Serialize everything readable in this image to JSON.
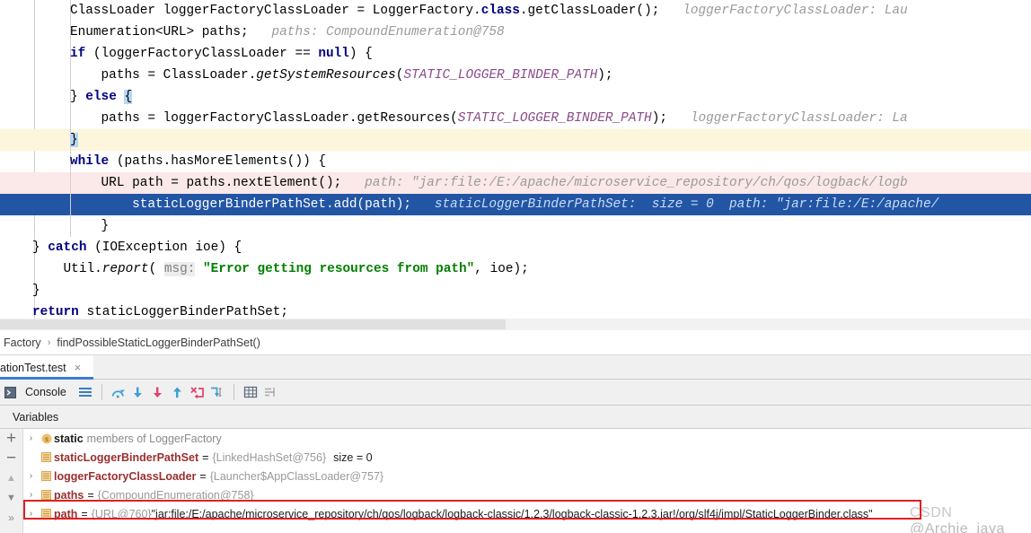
{
  "editor": {
    "lines": [
      {
        "id": "line-classloader",
        "indent": 78,
        "segments": [
          {
            "t": "ClassLoader loggerFactoryClassLoader = LoggerFactory.",
            "c": "plain"
          },
          {
            "t": "class",
            "c": "kw"
          },
          {
            "t": ".getClassLoader();",
            "c": "plain"
          },
          {
            "t": "   loggerFactoryClassLoader: Lau",
            "c": "hint"
          }
        ]
      },
      {
        "id": "line-enumeration",
        "indent": 78,
        "segments": [
          {
            "t": "Enumeration<URL> paths;",
            "c": "plain"
          },
          {
            "t": "   paths: CompoundEnumeration@758",
            "c": "hint"
          }
        ]
      },
      {
        "id": "line-if",
        "indent": 78,
        "segments": [
          {
            "t": "if",
            "c": "kw"
          },
          {
            "t": " (loggerFactoryClassLoader == ",
            "c": "plain"
          },
          {
            "t": "null",
            "c": "kw"
          },
          {
            "t": ") {",
            "c": "plain"
          }
        ]
      },
      {
        "id": "line-paths-system",
        "indent": 78,
        "segments": [
          {
            "t": "    paths = ClassLoader.",
            "c": "plain"
          },
          {
            "t": "getSystemResources",
            "c": "mth"
          },
          {
            "t": "(",
            "c": "plain"
          },
          {
            "t": "STATIC_LOGGER_BINDER_PATH",
            "c": "const"
          },
          {
            "t": ");",
            "c": "plain"
          }
        ]
      },
      {
        "id": "line-else",
        "indent": 78,
        "segments": [
          {
            "t": "} ",
            "c": "plain"
          },
          {
            "t": "else",
            "c": "kw"
          },
          {
            "t": " ",
            "c": "plain"
          },
          {
            "t": "{",
            "c": "brace-sel"
          }
        ]
      },
      {
        "id": "line-paths-resources",
        "indent": 78,
        "segments": [
          {
            "t": "    paths = loggerFactoryClassLoader.getResources(",
            "c": "plain"
          },
          {
            "t": "STATIC_LOGGER_BINDER_PATH",
            "c": "const"
          },
          {
            "t": ");",
            "c": "plain"
          },
          {
            "t": "   loggerFactoryClassLoader: La",
            "c": "hint"
          }
        ]
      },
      {
        "id": "line-close-else",
        "indent": 78,
        "highlight": "yellow",
        "segments": [
          {
            "t": "}",
            "c": "brace-sel"
          }
        ]
      },
      {
        "id": "line-while",
        "indent": 78,
        "segments": [
          {
            "t": "while",
            "c": "kw"
          },
          {
            "t": " (paths.hasMoreElements()) {",
            "c": "plain"
          }
        ]
      },
      {
        "id": "line-url-path",
        "indent": 78,
        "highlight": "pink",
        "segments": [
          {
            "t": "    URL path = paths.nextElement();",
            "c": "plain"
          },
          {
            "t": "   path: \"jar:file:/E:/apache/microservice_repository/ch/qos/logback/logb",
            "c": "hint"
          }
        ]
      },
      {
        "id": "line-add-path",
        "indent": 78,
        "highlight": "blue",
        "segments": [
          {
            "t": "        staticLoggerBinderPathSet.add(path);",
            "c": "plain"
          },
          {
            "t": "   staticLoggerBinderPathSet:  size = 0  path: \"jar:file:/E:/apache/",
            "c": "hint"
          }
        ]
      },
      {
        "id": "line-close-while",
        "indent": 78,
        "segments": [
          {
            "t": "    }",
            "c": "plain"
          }
        ]
      },
      {
        "id": "line-catch",
        "indent": 36,
        "segments": [
          {
            "t": "} ",
            "c": "plain"
          },
          {
            "t": "catch",
            "c": "kw"
          },
          {
            "t": " (IOException ioe) {",
            "c": "plain"
          }
        ]
      },
      {
        "id": "line-util-report",
        "indent": 36,
        "segments": [
          {
            "t": "    Util.",
            "c": "plain"
          },
          {
            "t": "report",
            "c": "mth"
          },
          {
            "t": "( ",
            "c": "plain"
          },
          {
            "t": "msg:",
            "c": "param"
          },
          {
            "t": " ",
            "c": "plain"
          },
          {
            "t": "\"Error getting resources from path\"",
            "c": "str"
          },
          {
            "t": ", ioe);",
            "c": "plain"
          }
        ]
      },
      {
        "id": "line-close-catch",
        "indent": 36,
        "segments": [
          {
            "t": "}",
            "c": "plain"
          }
        ]
      },
      {
        "id": "line-return",
        "indent": 36,
        "segments": [
          {
            "t": "return",
            "c": "kw"
          },
          {
            "t": " staticLoggerBinderPathSet;",
            "c": "plain"
          }
        ]
      },
      {
        "id": "line-close-method",
        "indent": 0,
        "segments": [
          {
            "t": "}",
            "c": "plain"
          }
        ]
      }
    ]
  },
  "breadcrumb": {
    "crumb1": "Factory",
    "separator": "›",
    "crumb2": "findPossibleStaticLoggerBinderPathSet()"
  },
  "run_tab": {
    "label": "ationTest.test",
    "close_icon": "×"
  },
  "debug_toolbar": {
    "console_label": "Console",
    "icons": [
      "console-toggle-icon",
      "list-view-icon",
      "step-over-icon",
      "step-into-icon",
      "force-step-into-icon",
      "step-out-icon",
      "drop-frame-icon",
      "run-to-cursor-icon",
      "evaluate-expression-icon",
      "mute-breakpoints-icon"
    ]
  },
  "variables_header": {
    "label": "Variables"
  },
  "variables_sidebar": {
    "add_icon": "+",
    "remove_icon": "−",
    "up_icon": "▲",
    "down_icon": "▼",
    "expand_icon": "»"
  },
  "variables": {
    "rows": [
      {
        "id": "row-static-members",
        "arrow": "›",
        "icon": "static-badge-icon",
        "static_label": "static",
        "static_suffix": "members of LoggerFactory",
        "name": "",
        "eq": "",
        "ref": "",
        "value": "",
        "size": ""
      },
      {
        "id": "row-staticLoggerBinderPathSet",
        "arrow": "",
        "icon": "field-icon",
        "name": "staticLoggerBinderPathSet",
        "eq": "=",
        "ref": "{LinkedHashSet@756}",
        "value": "",
        "size": "size = 0"
      },
      {
        "id": "row-loggerFactoryClassLoader",
        "arrow": "›",
        "icon": "field-icon",
        "name": "loggerFactoryClassLoader",
        "eq": "=",
        "ref": "{Launcher$AppClassLoader@757}",
        "value": "",
        "size": ""
      },
      {
        "id": "row-paths",
        "arrow": "›",
        "icon": "field-icon",
        "name": "paths",
        "eq": "=",
        "ref": "{CompoundEnumeration@758}",
        "value": "",
        "size": ""
      },
      {
        "id": "row-path",
        "arrow": "›",
        "icon": "field-icon",
        "name": "path",
        "eq": "=",
        "ref": "{URL@760}",
        "value": "\"jar:file:/E:/apache/microservice_repository/ch/qos/logback/logback-classic/1.2.3/logback-classic-1.2.3.jar!/org/slf4j/impl/StaticLoggerBinder.class\"",
        "size": ""
      }
    ]
  },
  "watermark": {
    "brand": "CSDN",
    "handle": "@Archie_java"
  },
  "colors": {
    "selection_blue": "#2255a4",
    "executing_yellow": "#fdf6dd",
    "pink_highlight": "#fbe8e8",
    "keyword_navy": "#000080",
    "string_green": "#008000",
    "constant_purple": "#8b4a8b",
    "hint_gray": "#9a9a9a",
    "var_name_red": "#9b2e2e",
    "red_box": "#e02020",
    "tab_underline": "#3d7bd6"
  }
}
